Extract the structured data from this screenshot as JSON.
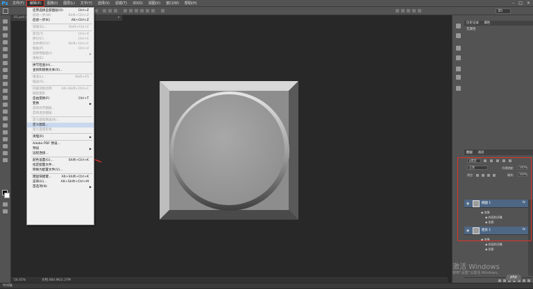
{
  "app": {
    "logo": "Ps"
  },
  "menubar": {
    "items": [
      "文件(F)",
      "编辑(E)",
      "图像(I)",
      "图层(L)",
      "文字(Y)",
      "选择(S)",
      "滤镜(T)",
      "3D(D)",
      "视图(V)",
      "窗口(W)",
      "帮助(H)"
    ],
    "active_index": 1
  },
  "window_controls": {
    "minimize": "–",
    "maximize": "□",
    "close": "×"
  },
  "options_bar": {
    "right_field": "3D"
  },
  "document": {
    "tab_label": "01.psd @ 54.4% (投影/RGB/8)",
    "tab_close": "×",
    "zoom": "54.45%",
    "doc_info": "文档:484.9K/2.37M"
  },
  "timeline": {
    "label": "时间轴"
  },
  "history_panel": {
    "tabs": [
      "历史记录",
      "属性"
    ],
    "item": "无属性"
  },
  "layers_panel": {
    "tabs": [
      "图层",
      "通道"
    ],
    "filter_kind": "ρ类型",
    "blend_mode": "正常",
    "opacity_label": "不透明度:",
    "opacity_value": "100%",
    "lock_label": "锁定:",
    "fill_label": "填充:",
    "fill_value": "100%",
    "layers": [
      {
        "name": "椭圆 1",
        "fx": "fx",
        "effects_label": "效果",
        "effects": [
          "斜面和浮雕",
          "投影"
        ]
      },
      {
        "name": "矩形 1",
        "fx": "fx",
        "effects_label": "效果",
        "effects": [
          "斜面和浮雕",
          "投影"
        ]
      }
    ]
  },
  "edit_menu": {
    "items": [
      {
        "label": "还原选择全部图层(O)",
        "shortcut": "Ctrl+Z",
        "disabled": false
      },
      {
        "label": "前进一步(W)",
        "shortcut": "Shift+Ctrl+Z",
        "disabled": true
      },
      {
        "label": "后退一步(K)",
        "shortcut": "Alt+Ctrl+Z",
        "disabled": false
      },
      {
        "sep": true
      },
      {
        "label": "渐隐(D)...",
        "shortcut": "Shift+Ctrl+F",
        "disabled": true
      },
      {
        "sep": true
      },
      {
        "label": "剪切(T)",
        "shortcut": "Ctrl+X",
        "disabled": true
      },
      {
        "label": "拷贝(C)",
        "shortcut": "Ctrl+C",
        "disabled": true
      },
      {
        "label": "合并拷贝(Y)",
        "shortcut": "Shift+Ctrl+C",
        "disabled": true
      },
      {
        "label": "粘贴(P)",
        "shortcut": "Ctrl+V",
        "disabled": true
      },
      {
        "label": "选择性粘贴(I)",
        "shortcut": "",
        "disabled": true,
        "submenu": true
      },
      {
        "label": "清除(E)",
        "shortcut": "",
        "disabled": true
      },
      {
        "sep": true
      },
      {
        "label": "拼写检查(H)...",
        "shortcut": "",
        "disabled": false
      },
      {
        "label": "查找和替换文本(X)...",
        "shortcut": "",
        "disabled": false
      },
      {
        "sep": true
      },
      {
        "label": "填充(L)...",
        "shortcut": "Shift+F5",
        "disabled": true
      },
      {
        "label": "描边(S)...",
        "shortcut": "",
        "disabled": true
      },
      {
        "sep": true
      },
      {
        "label": "内容识别比例",
        "shortcut": "Alt+Shift+Ctrl+C",
        "disabled": true
      },
      {
        "label": "操控变形",
        "shortcut": "",
        "disabled": true
      },
      {
        "label": "自由变换(F)",
        "shortcut": "Ctrl+T",
        "disabled": false
      },
      {
        "label": "变换",
        "shortcut": "",
        "disabled": false,
        "submenu": true
      },
      {
        "label": "自动对齐图层...",
        "shortcut": "",
        "disabled": true
      },
      {
        "label": "自动混合图层...",
        "shortcut": "",
        "disabled": true
      },
      {
        "sep": true
      },
      {
        "label": "定义画笔预设(B)...",
        "shortcut": "",
        "disabled": true
      },
      {
        "label": "定义图案...",
        "shortcut": "",
        "disabled": false,
        "highlight": true
      },
      {
        "label": "定义自定形状...",
        "shortcut": "",
        "disabled": true
      },
      {
        "sep": true
      },
      {
        "label": "清理(R)",
        "shortcut": "",
        "disabled": false,
        "submenu": true
      },
      {
        "sep": true
      },
      {
        "label": "Adobe PDF 预设...",
        "shortcut": "",
        "disabled": false
      },
      {
        "label": "预设",
        "shortcut": "",
        "disabled": false,
        "submenu": true
      },
      {
        "label": "远程连接...",
        "shortcut": "",
        "disabled": false
      },
      {
        "sep": true
      },
      {
        "label": "颜色设置(G)...",
        "shortcut": "Shift+Ctrl+K",
        "disabled": false
      },
      {
        "label": "指定配置文件...",
        "shortcut": "",
        "disabled": false
      },
      {
        "label": "转换为配置文件(V)...",
        "shortcut": "",
        "disabled": false
      },
      {
        "sep": true
      },
      {
        "label": "键盘快捷键...",
        "shortcut": "Alt+Shift+Ctrl+K",
        "disabled": false
      },
      {
        "label": "菜单(U)...",
        "shortcut": "Alt+Shift+Ctrl+M",
        "disabled": false
      },
      {
        "label": "首选项(N)",
        "shortcut": "",
        "disabled": false,
        "submenu": true
      }
    ]
  },
  "watermark": {
    "line1": "激活 Windows",
    "line2": "转到“设置”以激活 Windows。"
  },
  "badge": {
    "text": "php"
  },
  "colors": {
    "accent_red": "#e0332a",
    "layer_selected": "#4d6785",
    "canvas_bg": "#282828"
  }
}
